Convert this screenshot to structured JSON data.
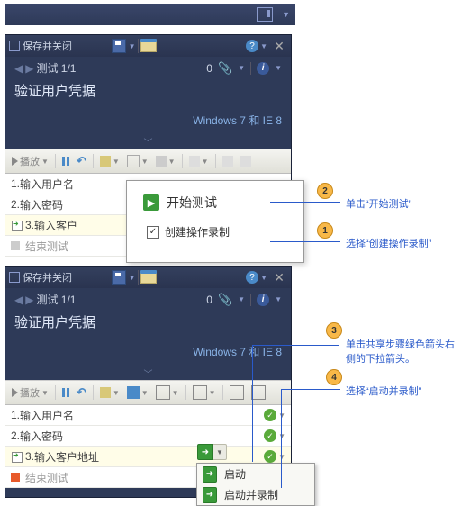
{
  "header_strip": {
    "present": true
  },
  "titlebar": {
    "title": "保存并关闭",
    "icons": [
      "save-icon",
      "open-folder-icon",
      "help-icon",
      "close-icon"
    ]
  },
  "nav": {
    "label": "测试 1/1",
    "count": "0",
    "info_tooltip": "i"
  },
  "heading": "验证用户凭据",
  "environment": "Windows 7 和 IE 8",
  "toolbar": {
    "play_label": "播放"
  },
  "steps_top": [
    {
      "num": "1.",
      "text": "输入用户名"
    },
    {
      "num": "2.",
      "text": "输入密码"
    },
    {
      "num": "3.",
      "text": "输入客户",
      "shared": true
    },
    {
      "text": "结束测试",
      "end": true,
      "gray": true
    }
  ],
  "start_popup": {
    "start_label": "开始测试",
    "checkbox_label": "创建操作录制",
    "checked": true
  },
  "steps_bottom": [
    {
      "num": "1.",
      "text": "输入用户名",
      "status": "pass"
    },
    {
      "num": "2.",
      "text": "输入密码",
      "status": "pass"
    },
    {
      "num": "3.",
      "text": "输入客户地址",
      "shared": true,
      "status": "pass"
    },
    {
      "text": "结束测试",
      "end": true,
      "end_active": true,
      "gray": true
    }
  ],
  "launch_menu": {
    "item1": "启动",
    "item2": "启动并录制"
  },
  "callouts": {
    "c1": {
      "num": "1",
      "text": "选择“创建操作录制”"
    },
    "c2": {
      "num": "2",
      "text": "单击“开始测试”"
    },
    "c3": {
      "num": "3",
      "text": "单击共享步骤绿色箭头右侧的下拉箭头。"
    },
    "c4": {
      "num": "4",
      "text": "选择“启动并录制”"
    }
  }
}
